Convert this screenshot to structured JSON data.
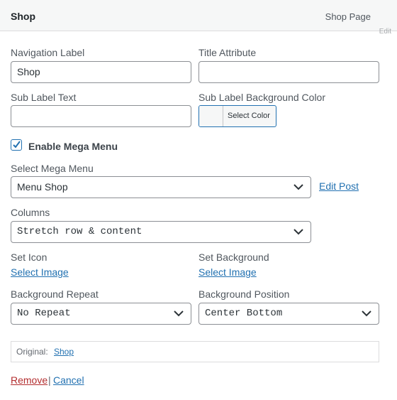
{
  "header": {
    "title": "Shop",
    "type_label": "Shop Page",
    "edit_label": "Edit"
  },
  "fields": {
    "navigation_label": {
      "label": "Navigation Label",
      "value": "Shop"
    },
    "title_attribute": {
      "label": "Title Attribute",
      "value": ""
    },
    "sub_label_text": {
      "label": "Sub Label Text",
      "value": ""
    },
    "sub_label_bg": {
      "label": "Sub Label Background Color",
      "button": "Select Color"
    },
    "enable_mega_menu": {
      "label": "Enable Mega Menu",
      "checked": true
    },
    "select_mega_menu": {
      "label": "Select Mega Menu",
      "value": "Menu Shop",
      "edit_link": "Edit Post"
    },
    "columns": {
      "label": "Columns",
      "value": "Stretch row & content"
    },
    "set_icon": {
      "label": "Set Icon",
      "link": "Select Image"
    },
    "set_background": {
      "label": "Set Background",
      "link": "Select Image"
    },
    "background_repeat": {
      "label": "Background Repeat",
      "value": "No Repeat"
    },
    "background_position": {
      "label": "Background Position",
      "value": "Center Bottom"
    }
  },
  "original": {
    "label": "Original:",
    "link": "Shop"
  },
  "actions": {
    "remove": "Remove",
    "separator": "|",
    "cancel": "Cancel"
  },
  "colors": {
    "link": "#2271b1",
    "remove": "#b32d2e",
    "border": "#8c8f94"
  }
}
